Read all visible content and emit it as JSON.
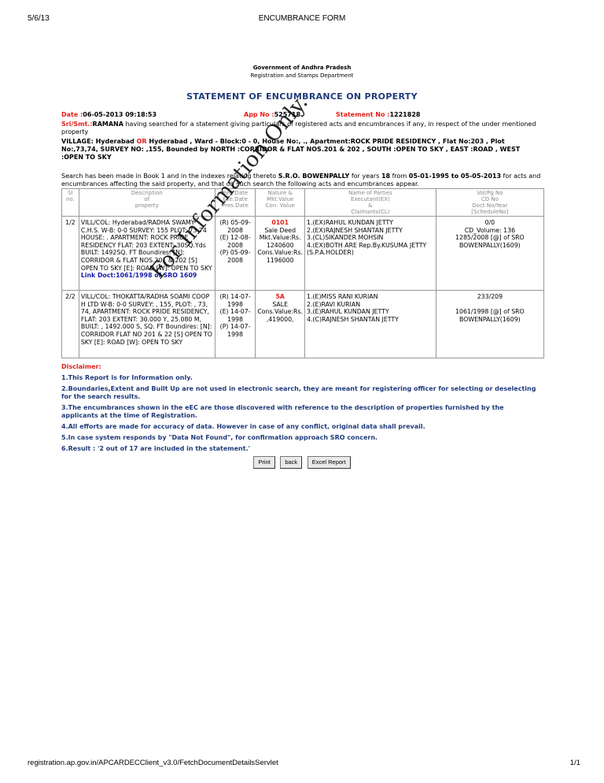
{
  "page_header": {
    "date": "5/6/13",
    "title": "ENCUMBRANCE FORM"
  },
  "page_footer": {
    "url": "registration.ap.gov.in/APCARDECClient_v3.0/FetchDocumentDetailsServlet",
    "page": "1/1"
  },
  "doc": {
    "gov": "Government of Andhra Pradesh",
    "dept": "Registration and Stamps Department",
    "title": "STATEMENT OF ENCUMBRANCE ON PROPERTY"
  },
  "meta": {
    "date_label": "Date :",
    "date_value": "06-05-2013 09:18:53",
    "app_label": "App No :",
    "app_value": "525718",
    "stmt_label": "Statement No :",
    "stmt_value": "1221828",
    "sri_label": "Sri/Smt.:",
    "sri_name": "RAMANA",
    "sri_text": " having searched for a statement giving particulars of registered acts and encumbrances if any, in respect of the under mentioned property",
    "village_a": "VILLAGE: Hyderabad ",
    "village_or": "OR",
    "village_b": " Hyderabad , Ward - Block:0 - 0, House No:, ., Apartment:ROCK PRIDE RESIDENCY , Flat No:203 , Plot No:,73,74, SURVEY NO: ,155, Bounded by NORTH :CORRIDOR & FLAT NOS.201 & 202 , SOUTH :OPEN TO SKY , EAST :ROAD , WEST :OPEN TO SKY",
    "search_a": "Search has been made in Book 1 and in the indexes relating thereto ",
    "search_sro": "S.R.O. BOWENPALLY",
    "search_b": " for years ",
    "search_years": "18",
    "search_c": " from ",
    "search_range": "05-01-1995 to 05-05-2013",
    "search_d": " for acts and encumbrances affecting the said property, and that on such search the following acts and encumbrances appear."
  },
  "table": {
    "headers": [
      "Sl\nno.",
      "Description\nof\nproperty",
      "Reg.Date\nExe.Date\nPres.Date",
      "Nature &\nMkt.Value\nCon. Value",
      "Name of Parties\nExecutant(EX)\n&\nClaimants(CL)",
      "Vol/Pg No\nCD No\nDoct No/Year\n[ScheduleNo]"
    ],
    "rows": [
      {
        "sl": "1/2",
        "desc": "VILL/COL: Hyderabad/RADHA SWAMY C.H.S. W-B: 0-0 SURVEY: 155 PLOT: 73 74 HOUSE: . APARTMENT: ROCK PRIDE RESIDENCY FLAT: 203 EXTENT: 30SQ.Yds BUILT: 1492SQ. FT Boundires: [N]: CORRIDOR & FLAT NOS.201 & 202 [S] OPEN TO SKY [E]: ROAD [W]: OPEN TO SKY",
        "link": "Link Doct:1061/1998 of SRO 1609",
        "dates": "(R) 05-09-2008\n(E) 12-08-2008\n(P) 05-09-2008",
        "nature_code": "0101",
        "nature_text": "Sale Deed\nMkt.Value:Rs. 1240600\nCons.Value:Rs. 1196000",
        "parties": "1.(EX)RAHUL KUNDAN JETTY\n2.(EX)RAJNESH SHANTAN JETTY\n3.(CL)SIKANDER MOHSIN\n4.(EX)BOTH ARE Rep.By.KUSUMA JETTY (S.P.A.HOLDER)",
        "vol": "0/0\nCD_Volume: 136\n1285/2008 [@] of SRO BOWENPALLY(1609)"
      },
      {
        "sl": "2/2",
        "desc": "VILL/COL: THOKATTA/RADHA SOAMI COOP H LTD W-B: 0-0 SURVEY: , 155, PLOT: , 73, 74, APARTMENT: ROCK PRIDE RESIDENCY, FLAT: 203 EXTENT: 30.000 Y, 25.080 M, BUILT: , 1492.000 S, SQ. FT Boundires: [N]: CORRIDOR FLAT NO 201 & 22 [S] OPEN TO SKY [E]: ROAD [W]: OPEN TO SKY",
        "link": "",
        "dates": "(R) 14-07-1998\n(E) 14-07-1998\n(P) 14-07-1998",
        "nature_code": "5A",
        "nature_text": "SALE\nCons.Value:Rs. ,419000,",
        "parties": "1.(E)MISS RANI KURIAN\n2.(E)RAVI KURIAN\n3.(E)RAHUL KUNDAN JETTY\n4.(C)RAJNESH SHANTAN JETTY",
        "vol": "233/209\n\n1061/1998 [@] of SRO BOWENPALLY(1609)"
      }
    ]
  },
  "disclaimer": {
    "heading": "Disclaimer:",
    "items": [
      "1.This Report is for Information only.",
      "2.Boundaries,Extent and Built Up are not used in electronic search, they are meant for registering officer for selecting or deselecting for the search results.",
      "3.The encumbrances shown in the eEC are those discovered with reference to the description of properties furnished by the applicants at the time of Registration.",
      "4.All efforts are made for accuracy of data. However in case of any conflict, original data shall prevail.",
      "5.In case system responds by \"Data Not Found\", for confirmation approach SRO concern.",
      "6.Result : '2 out of 17 are included in the statement.'"
    ]
  },
  "buttons": {
    "print": "Print",
    "back": "back",
    "excel": "Excel Report"
  },
  "watermark": "For Information Only."
}
